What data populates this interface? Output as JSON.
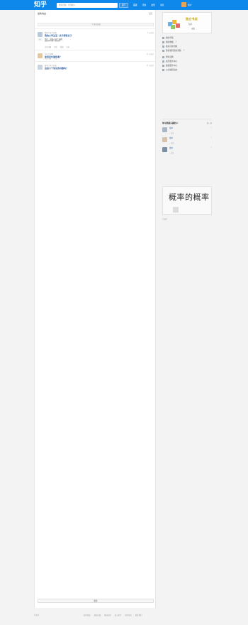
{
  "header": {
    "logo": "知乎",
    "search_placeholder": "搜索话题、问题或人",
    "ask_label": "提问",
    "nav": [
      "首页",
      "话题",
      "发现",
      "消息"
    ],
    "user_name": "用户"
  },
  "feed": {
    "title": "最新动态",
    "settings": "设置",
    "new_notice": "↑ 1 条新动态",
    "more_label": "更多"
  },
  "items": [
    {
      "meta": "赞同了这个回答",
      "time": "6 分钟前",
      "title": "我的大学生活 · 关于那段日子",
      "author": "用户 · 浏览过这个问题",
      "body": "这段时间我一直在想……",
      "votes": "20",
      "actions": [
        "关注问题",
        "评论",
        "感谢",
        "分享"
      ]
    },
    {
      "meta": "关注了问题",
      "time": "10 分钟前",
      "title": "如何评价某件事？",
      "author": "",
      "body": "",
      "votes": "",
      "actions": [
        "关注问题",
        "评论"
      ]
    },
    {
      "meta": "赞同了这个回答",
      "time": "15 分钟前",
      "title": "这是一个常见的问题吗？",
      "author": "",
      "body": "",
      "votes": "12",
      "actions": [
        "关注问题"
      ]
    }
  ],
  "sidebar": {
    "banner": {
      "title": "独立书店",
      "sub": "知乎",
      "cta": "查看"
    },
    "links": [
      {
        "label": "我的草稿",
        "badge": ""
      },
      {
        "label": "我的收藏",
        "badge": "2"
      },
      {
        "label": "我关注的问题",
        "badge": ""
      },
      {
        "label": "邀请我回答的问题",
        "badge": "3"
      },
      {
        "label": "所有话题",
        "badge": ""
      },
      {
        "label": "社区服务中心",
        "badge": ""
      },
      {
        "label": "版权服务中心",
        "badge": ""
      },
      {
        "label": "公共编辑动态",
        "badge": ""
      }
    ],
    "rec_title": "你可能感兴趣的人",
    "rec_more": "换一换",
    "recommendations": [
      {
        "name": "用户",
        "desc": "",
        "follow": "+ 关注"
      },
      {
        "name": "用户",
        "desc": "",
        "follow": "+ 关注"
      },
      {
        "name": "用户",
        "desc": "",
        "follow": "+ 关注"
      }
    ],
    "book": {
      "title": "概率的概率",
      "sub": "",
      "tag": ""
    },
    "footer": "© 知乎"
  },
  "footer": {
    "links": [
      "知乎指南",
      "建议反馈",
      "移动应用",
      "加入知乎",
      "知乎协议",
      "联系我们"
    ],
    "copyright": "© 知乎"
  }
}
